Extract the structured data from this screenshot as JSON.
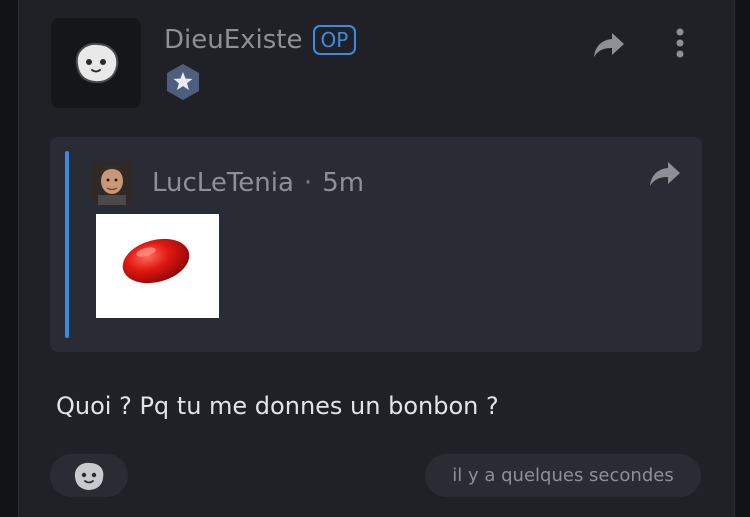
{
  "post": {
    "author": "DieuExiste",
    "op_badge": "OP",
    "author_avatar_icon": "smiley-face-icon",
    "rank_icon": "star-hexagon-icon",
    "share_icon": "share-arrow-icon",
    "menu_icon": "more-vertical-icon",
    "quote": {
      "author": "LucLeTenia",
      "separator": "·",
      "time": "5m",
      "share_icon": "share-arrow-icon",
      "image_icon": "red-candy-image"
    },
    "message": "Quoi ? Pq tu me donnes un bonbon ?",
    "reaction_icon": "add-reaction-icon",
    "timestamp": "il y a quelques secondes"
  },
  "colors": {
    "accent": "#3d8be0",
    "background": "#1f2126",
    "quote_background": "#292c35",
    "text": "#e3e4e8",
    "muted_text": "#8f9096"
  }
}
